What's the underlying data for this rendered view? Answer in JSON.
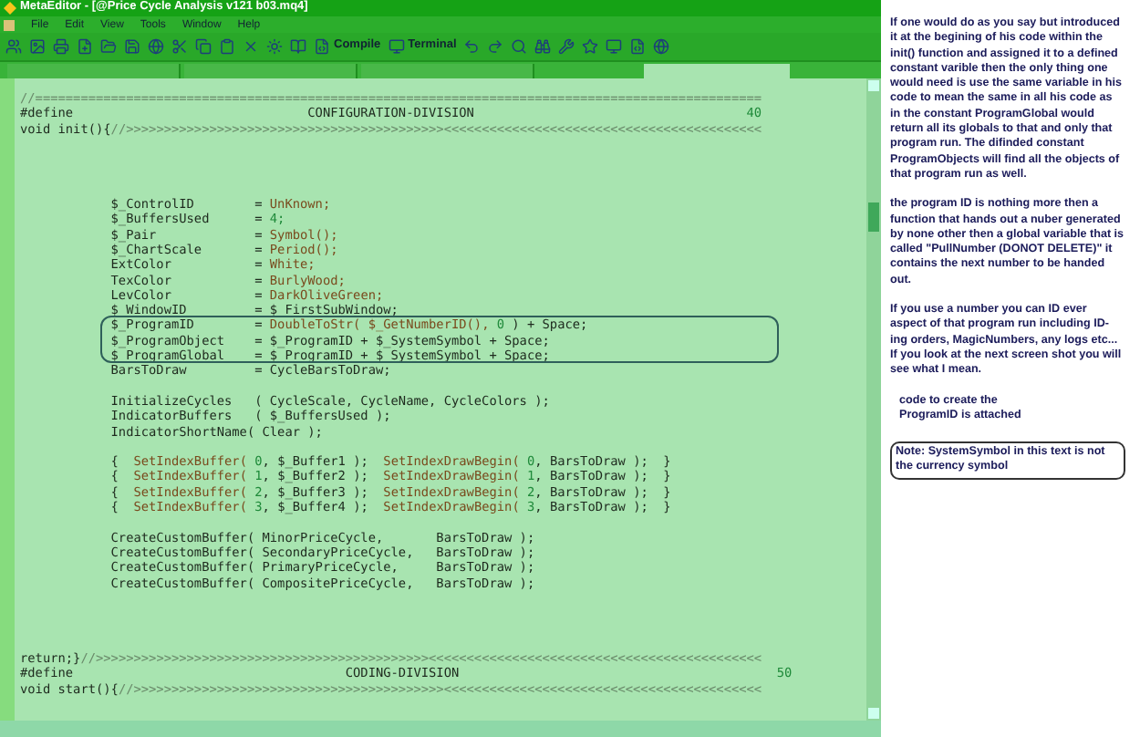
{
  "window": {
    "title": "MetaEditor - [@Price Cycle Analysis v121 b03.mq4]"
  },
  "menu": [
    "File",
    "Edit",
    "View",
    "Tools",
    "Window",
    "Help"
  ],
  "toolbar": {
    "compile": "Compile",
    "terminal": "Terminal"
  },
  "tabs": [
    {
      "selected": false
    },
    {
      "selected": false
    },
    {
      "selected": false
    },
    {
      "selected": true
    }
  ],
  "code": [
    {
      "kind": "code",
      "segments": [
        {
          "kind": "comment",
          "text": "//================================================================================================"
        }
      ]
    },
    {
      "kind": "code",
      "segments": [
        {
          "kind": "plain",
          "text": "#define                               CONFIGURATION-DIVISION                                    "
        },
        {
          "kind": "number",
          "text": "40"
        }
      ]
    },
    {
      "kind": "code",
      "segments": [
        {
          "kind": "plain",
          "text": "void init(){"
        },
        {
          "kind": "comment",
          "text": "//>>>>>>>>>>>>>>>>>>>>>>>>>>>>>>>>>>>>>>>>>><<<<<<<<<<<<<<<<<<<<<<<<<<<<<<<<<<<<<<<<<<"
        }
      ]
    },
    {
      "kind": "blank"
    },
    {
      "kind": "blank"
    },
    {
      "kind": "blank"
    },
    {
      "kind": "blank"
    },
    {
      "kind": "code",
      "segments": [
        {
          "kind": "plain",
          "text": "            $_ControlID        = "
        },
        {
          "kind": "value",
          "text": "UnKnown;"
        }
      ]
    },
    {
      "kind": "code",
      "segments": [
        {
          "kind": "plain",
          "text": "            $_BuffersUsed      = "
        },
        {
          "kind": "number",
          "text": "4;"
        }
      ]
    },
    {
      "kind": "code",
      "segments": [
        {
          "kind": "plain",
          "text": "            $_Pair             = "
        },
        {
          "kind": "value",
          "text": "Symbol();"
        }
      ]
    },
    {
      "kind": "code",
      "segments": [
        {
          "kind": "plain",
          "text": "            $_ChartScale       = "
        },
        {
          "kind": "value",
          "text": "Period();"
        }
      ]
    },
    {
      "kind": "code",
      "segments": [
        {
          "kind": "plain",
          "text": "            ExtColor           = "
        },
        {
          "kind": "value",
          "text": "White;"
        }
      ]
    },
    {
      "kind": "code",
      "segments": [
        {
          "kind": "plain",
          "text": "            TexColor           = "
        },
        {
          "kind": "value",
          "text": "BurlyWood;"
        }
      ]
    },
    {
      "kind": "code",
      "segments": [
        {
          "kind": "plain",
          "text": "            LevColor           = "
        },
        {
          "kind": "value",
          "text": "DarkOliveGreen;"
        }
      ]
    },
    {
      "kind": "code",
      "segments": [
        {
          "kind": "plain",
          "text": "            $_WindowID         = $_FirstSubWindow;"
        }
      ]
    },
    {
      "kind": "code",
      "boxed": true,
      "segments": [
        {
          "kind": "plain",
          "text": "            $_ProgramID        = "
        },
        {
          "kind": "value",
          "text": "DoubleToStr( $_GetNumberID(), "
        },
        {
          "kind": "number",
          "text": "0"
        },
        {
          "kind": "plain",
          "text": " ) + Space;"
        }
      ]
    },
    {
      "kind": "code",
      "boxed": true,
      "segments": [
        {
          "kind": "plain",
          "text": "            $_ProgramObject    = $_ProgramID + $_SystemSymbol + Space;"
        }
      ]
    },
    {
      "kind": "code",
      "boxed": true,
      "segments": [
        {
          "kind": "plain",
          "text": "            $_ProgramGlobal    = $_ProgramID + $_SystemSymbol + Space;"
        }
      ]
    },
    {
      "kind": "code",
      "segments": [
        {
          "kind": "plain",
          "text": "            BarsToDraw         = CycleBarsToDraw;"
        }
      ]
    },
    {
      "kind": "blank"
    },
    {
      "kind": "code",
      "segments": [
        {
          "kind": "plain",
          "text": "            InitializeCycles   ( CycleScale, CycleName, CycleColors );"
        }
      ]
    },
    {
      "kind": "code",
      "segments": [
        {
          "kind": "plain",
          "text": "            IndicatorBuffers   ( $_BuffersUsed );"
        }
      ]
    },
    {
      "kind": "code",
      "segments": [
        {
          "kind": "plain",
          "text": "            IndicatorShortName( Clear );"
        }
      ]
    },
    {
      "kind": "blank"
    },
    {
      "kind": "code",
      "segments": [
        {
          "kind": "plain",
          "text": "            {  "
        },
        {
          "kind": "value",
          "text": "SetIndexBuffer( "
        },
        {
          "kind": "number",
          "text": "0"
        },
        {
          "kind": "plain",
          "text": ", $_Buffer1 );  "
        },
        {
          "kind": "value",
          "text": "SetIndexDrawBegin( "
        },
        {
          "kind": "number",
          "text": "0"
        },
        {
          "kind": "plain",
          "text": ", BarsToDraw );  }"
        }
      ]
    },
    {
      "kind": "code",
      "segments": [
        {
          "kind": "plain",
          "text": "            {  "
        },
        {
          "kind": "value",
          "text": "SetIndexBuffer( "
        },
        {
          "kind": "number",
          "text": "1"
        },
        {
          "kind": "plain",
          "text": ", $_Buffer2 );  "
        },
        {
          "kind": "value",
          "text": "SetIndexDrawBegin( "
        },
        {
          "kind": "number",
          "text": "1"
        },
        {
          "kind": "plain",
          "text": ", BarsToDraw );  }"
        }
      ]
    },
    {
      "kind": "code",
      "segments": [
        {
          "kind": "plain",
          "text": "            {  "
        },
        {
          "kind": "value",
          "text": "SetIndexBuffer( "
        },
        {
          "kind": "number",
          "text": "2"
        },
        {
          "kind": "plain",
          "text": ", $_Buffer3 );  "
        },
        {
          "kind": "value",
          "text": "SetIndexDrawBegin( "
        },
        {
          "kind": "number",
          "text": "2"
        },
        {
          "kind": "plain",
          "text": ", BarsToDraw );  }"
        }
      ]
    },
    {
      "kind": "code",
      "segments": [
        {
          "kind": "plain",
          "text": "            {  "
        },
        {
          "kind": "value",
          "text": "SetIndexBuffer( "
        },
        {
          "kind": "number",
          "text": "3"
        },
        {
          "kind": "plain",
          "text": ", $_Buffer4 );  "
        },
        {
          "kind": "value",
          "text": "SetIndexDrawBegin( "
        },
        {
          "kind": "number",
          "text": "3"
        },
        {
          "kind": "plain",
          "text": ", BarsToDraw );  }"
        }
      ]
    },
    {
      "kind": "blank"
    },
    {
      "kind": "code",
      "segments": [
        {
          "kind": "plain",
          "text": "            CreateCustomBuffer( MinorPriceCycle,       BarsToDraw );"
        }
      ]
    },
    {
      "kind": "code",
      "segments": [
        {
          "kind": "plain",
          "text": "            CreateCustomBuffer( SecondaryPriceCycle,   BarsToDraw );"
        }
      ]
    },
    {
      "kind": "code",
      "segments": [
        {
          "kind": "plain",
          "text": "            CreateCustomBuffer( PrimaryPriceCycle,     BarsToDraw );"
        }
      ]
    },
    {
      "kind": "code",
      "segments": [
        {
          "kind": "plain",
          "text": "            CreateCustomBuffer( CompositePriceCycle,   BarsToDraw );"
        }
      ]
    },
    {
      "kind": "blank"
    },
    {
      "kind": "blank"
    },
    {
      "kind": "blank"
    },
    {
      "kind": "blank"
    },
    {
      "kind": "code",
      "segments": [
        {
          "kind": "plain",
          "text": "return;}"
        },
        {
          "kind": "comment",
          "text": "//>>>>>>>>>>>>>>>>>>>>>>>>>>>>>>>>>>>>>>>>>>>><<<<<<<<<<<<<<<<<<<<<<<<<<<<<<<<<<<<<<<<<<<<"
        }
      ]
    },
    {
      "kind": "code",
      "segments": [
        {
          "kind": "plain",
          "text": "#define                                    CODING-DIVISION                                          "
        },
        {
          "kind": "number",
          "text": "50"
        }
      ]
    },
    {
      "kind": "code",
      "segments": [
        {
          "kind": "plain",
          "text": "void start(){"
        },
        {
          "kind": "comment",
          "text": "//>>>>>>>>>>>>>>>>>>>>>>>>>>>>>>>>>>>>>>>>><<<<<<<<<<<<<<<<<<<<<<<<<<<<<<<<<<<<<<<<<<"
        }
      ]
    }
  ],
  "notes": {
    "paragraphs": [
      "If one would do as you say but introduced it  at the begining of his code within the init() function and assigned it to a defined constant varible then the only thing one would need is use the same variable in his code to mean the same in all his code as in the constant ProgramGlobal would return all its globals to that and only that program run. The difinded constant ProgramObjects will find all the objects of that program run as well.",
      "the program ID is nothing more then a function that hands out a nuber generated by none other then a global variable that is called \"PullNumber (DONOT DELETE)\" it contains the next number to be handed out.",
      "If you use a number you can ID ever aspect of that program run including ID-ing orders, MagicNumbers, any logs etc... If you look at the next screen shot you will see what I mean.",
      "code to create the ProgramID is attached"
    ],
    "note": "Note: SystemSymbol in this text is not the currency symbol"
  }
}
